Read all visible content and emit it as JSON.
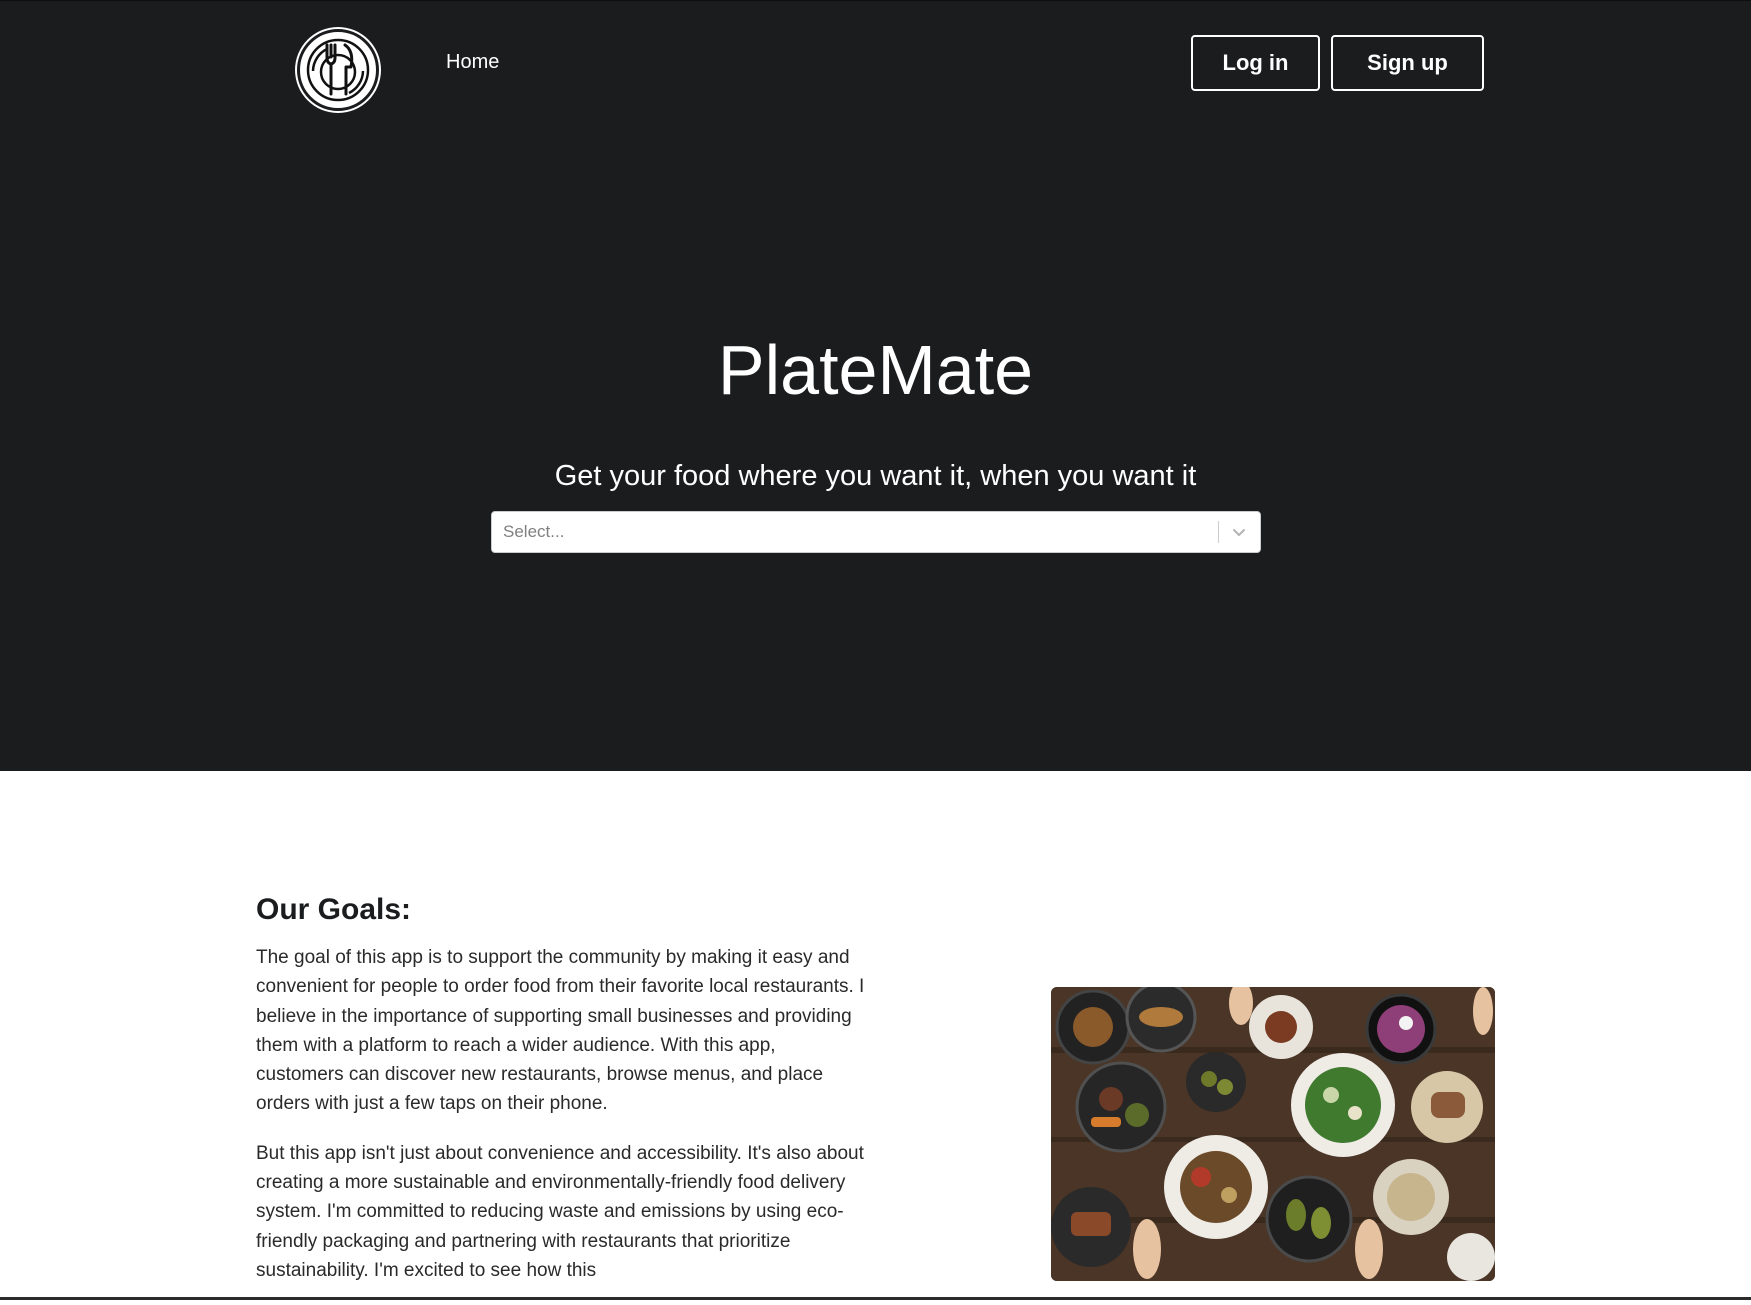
{
  "header": {
    "logo_icon": "plate-fork-knife-icon",
    "nav_home": "Home",
    "login_label": "Log in",
    "signup_label": "Sign up"
  },
  "hero": {
    "title": "PlateMate",
    "subtitle": "Get your food where you want it, when you want it",
    "select": {
      "placeholder": "Select...",
      "icon": "chevron-down-icon"
    }
  },
  "goals": {
    "heading": "Our Goals:",
    "paragraph_1": "The goal of this app is to support the community by making it easy and convenient for people to order food from their favorite local restaurants. I believe in the importance of supporting small businesses and providing them with a platform to reach a wider audience. With this app, customers can discover new restaurants, browse menus, and place orders with just a few taps on their phone.",
    "paragraph_2": "But this app isn't just about convenience and accessibility. It's also about creating a more sustainable and environmentally-friendly food delivery system. I'm committed to reducing waste and emissions by using eco-friendly packaging and partnering with restaurants that prioritize sustainability. I'm excited to see how this"
  },
  "colors": {
    "hero_background": "#1b1c1e",
    "page_background": "#ffffff",
    "text_light": "#ffffff",
    "text_dark": "#1b1c1e"
  }
}
